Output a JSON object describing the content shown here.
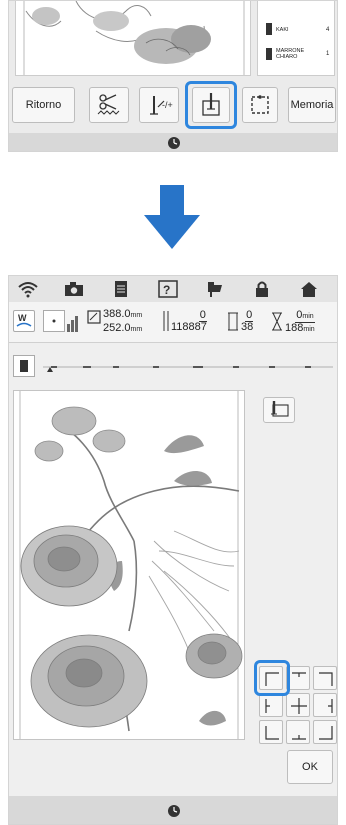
{
  "top_screen": {
    "threads": [
      {
        "name": "KAKI",
        "count": "4"
      },
      {
        "name": "MARRONE\nCHIARO",
        "count": "1"
      }
    ],
    "buttons": {
      "return_label": "Ritorno",
      "memory_label": "Memoria"
    }
  },
  "arrow": {
    "color": "#2874c8"
  },
  "bottom_screen": {
    "size": {
      "width": "388.0",
      "height": "252.0",
      "unit": "mm"
    },
    "stitch_counter": {
      "current": "0",
      "total": "118887"
    },
    "color_counter": {
      "current": "0",
      "total": "38"
    },
    "time_counter": {
      "current": "0",
      "total": "188",
      "unit": "min"
    },
    "ok_label": "OK"
  },
  "colors": {
    "highlight": "#2e86de",
    "panel": "#ebebeb"
  },
  "icons": {
    "status_bar": [
      "wifi-icon",
      "camera-icon",
      "document-icon",
      "help-icon",
      "thread-icon",
      "lock-icon",
      "home-icon"
    ]
  }
}
